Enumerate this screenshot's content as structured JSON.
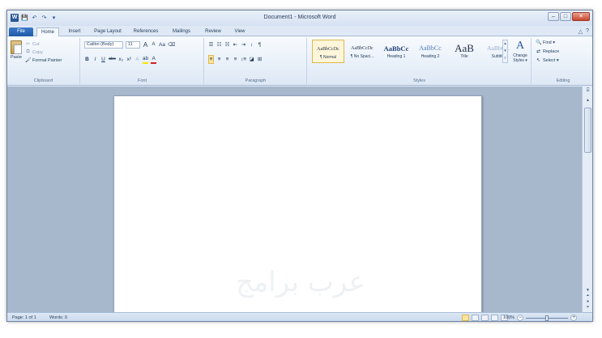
{
  "window": {
    "title": "Document1 - Microsoft Word"
  },
  "qat": {
    "app_icon": "W",
    "save": "💾",
    "undo": "↶",
    "redo": "↷",
    "customize": "▾"
  },
  "window_controls": {
    "minimize": "–",
    "maximize": "□",
    "close": "✕"
  },
  "tabs": [
    {
      "label": "File"
    },
    {
      "label": "Home"
    },
    {
      "label": "Insert"
    },
    {
      "label": "Page Layout"
    },
    {
      "label": "References"
    },
    {
      "label": "Mailings"
    },
    {
      "label": "Review"
    },
    {
      "label": "View"
    }
  ],
  "tabbar_right": {
    "minimize_ribbon": "△",
    "help": "?"
  },
  "clipboard": {
    "label": "Clipboard",
    "paste": "Paste",
    "cut": "Cut",
    "copy": "Copy",
    "format_painter": "Format Painter"
  },
  "font": {
    "label": "Font",
    "name": "Calibri (Body)",
    "size": "11",
    "grow": "A",
    "shrink": "A",
    "change_case": "Aa",
    "clear": "⌫",
    "bold": "B",
    "italic": "I",
    "underline": "U",
    "strike": "abc",
    "subscript": "x₂",
    "superscript": "x²",
    "effects": "A",
    "highlight": "ab",
    "color": "A"
  },
  "paragraph": {
    "label": "Paragraph",
    "bullets": "☰",
    "numbering": "☷",
    "multilevel": "☵",
    "decrease_indent": "⇤",
    "increase_indent": "⇥",
    "sort": "↕",
    "show_marks": "¶",
    "align_left": "≡",
    "center": "≡",
    "align_right": "≡",
    "justify": "≡",
    "line_spacing": "↕≡",
    "shading": "◪",
    "borders": "⊞"
  },
  "styles": {
    "label": "Styles",
    "items": [
      {
        "preview": "AaBbCcDc",
        "name": "¶ Normal"
      },
      {
        "preview": "AaBbCcDc",
        "name": "¶ No Spaci..."
      },
      {
        "preview": "AaBbCc",
        "name": "Heading 1"
      },
      {
        "preview": "AaBbCc",
        "name": "Heading 2"
      },
      {
        "preview": "AaB",
        "name": "Title"
      },
      {
        "preview": "AaBbCc.",
        "name": "Subtitle"
      }
    ],
    "change_styles": "Change Styles ▾",
    "change_icon": "A"
  },
  "editing": {
    "label": "Editing",
    "find": "Find ▾",
    "replace": "Replace",
    "select": "Select ▾"
  },
  "watermark": "عرب برامج",
  "status": {
    "page": "Page: 1 of 1",
    "words": "Words: 0",
    "zoom": "100%"
  },
  "zoom_level": 1.0,
  "colors": {
    "accent": "#2b5797",
    "highlight": "#f5e800",
    "font_color": "#d42020",
    "close_button": "#c9452c"
  }
}
